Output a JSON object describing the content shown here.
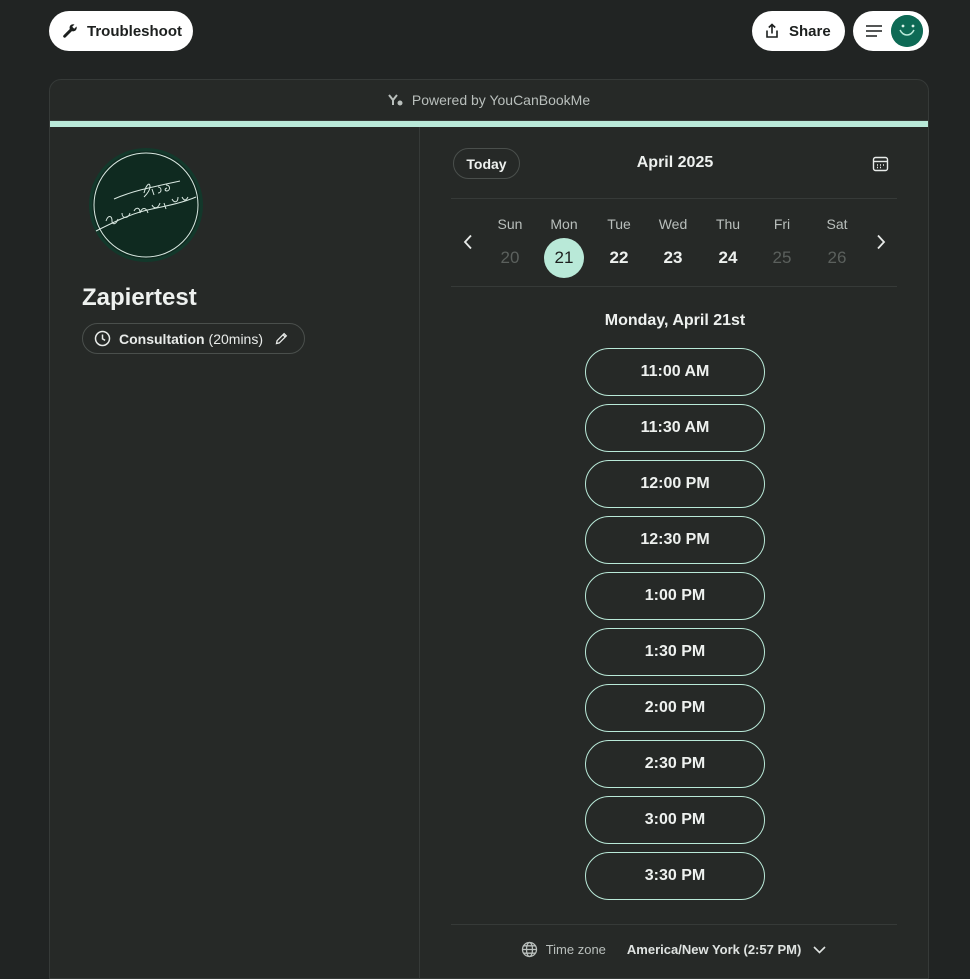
{
  "topbar": {
    "troubleshoot_label": "Troubleshoot",
    "share_label": "Share"
  },
  "card": {
    "powered_by": "Powered by YouCanBookMe",
    "accent_color": "#b9e9d8"
  },
  "profile": {
    "name": "Zapiertest",
    "event_title": "Consultation",
    "event_duration": "(20mins)"
  },
  "calendar": {
    "today_label": "Today",
    "month_label": "April 2025",
    "days": [
      {
        "dow": "Sun",
        "num": "20",
        "state": "disabled"
      },
      {
        "dow": "Mon",
        "num": "21",
        "state": "selected"
      },
      {
        "dow": "Tue",
        "num": "22",
        "state": "available"
      },
      {
        "dow": "Wed",
        "num": "23",
        "state": "available"
      },
      {
        "dow": "Thu",
        "num": "24",
        "state": "available"
      },
      {
        "dow": "Fri",
        "num": "25",
        "state": "disabled"
      },
      {
        "dow": "Sat",
        "num": "26",
        "state": "disabled"
      }
    ],
    "selected_date_heading": "Monday, April 21st",
    "slots": [
      "11:00 AM",
      "11:30 AM",
      "12:00 PM",
      "12:30 PM",
      "1:00 PM",
      "1:30 PM",
      "2:00 PM",
      "2:30 PM",
      "3:00 PM",
      "3:30 PM"
    ]
  },
  "timezone": {
    "label": "Time zone",
    "value": "America/New York (2:57 PM)"
  }
}
